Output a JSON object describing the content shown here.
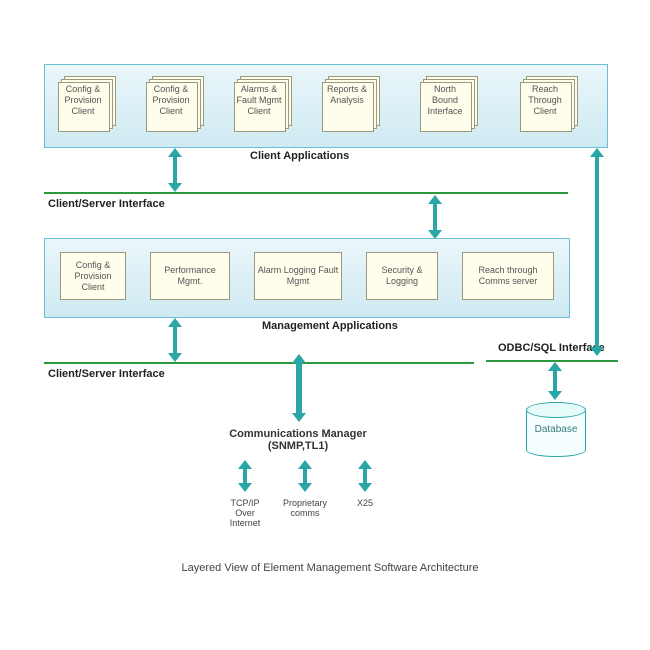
{
  "layers": {
    "client_apps": {
      "title": "Client Applications",
      "boxes": [
        "Config & Provision Client",
        "Config & Provision Client",
        "Alarms & Fault Mgmt Client",
        "Reports & Analysis",
        "North Bound Interface",
        "Reach Through Client"
      ]
    },
    "mgmt_apps": {
      "title": "Management Applications",
      "boxes": [
        "Config & Provision Client",
        "Performance Mgmt.",
        "Alarm Logging Fault Mgmt",
        "Security & Logging",
        "Reach through Comms server"
      ]
    }
  },
  "interfaces": {
    "cs1": "Client/Server Interface",
    "cs2": "Client/Server Interface",
    "odbc": "ODBC/SQL Interface"
  },
  "comm_manager": {
    "title_line1": "Communications Manager",
    "title_line2": "(SNMP,TL1)",
    "protocols": [
      "TCP/IP Over Internet",
      "Proprietary comms",
      "X25"
    ]
  },
  "database": {
    "label": "Database"
  },
  "caption": "Layered View of Element Management Software Architecture"
}
